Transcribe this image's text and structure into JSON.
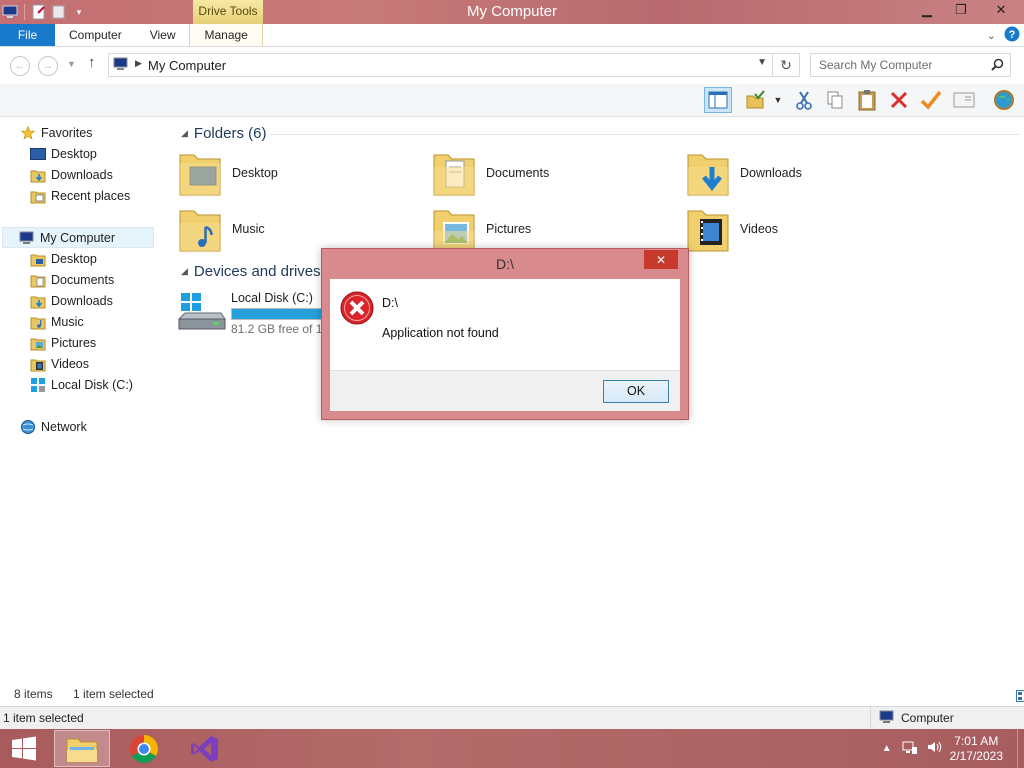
{
  "window": {
    "title": "My Computer",
    "contextual_tab": "Drive Tools"
  },
  "ribbon": {
    "tabs": [
      "File",
      "Computer",
      "View",
      "Manage"
    ]
  },
  "address": {
    "path": "My Computer",
    "search_placeholder": "Search My Computer"
  },
  "nav": {
    "favorites_label": "Favorites",
    "favorites": [
      "Desktop",
      "Downloads",
      "Recent places"
    ],
    "computer_label": "My Computer",
    "computer_items": [
      "Desktop",
      "Documents",
      "Downloads",
      "Music",
      "Pictures",
      "Videos",
      "Local Disk (C:)"
    ],
    "network_label": "Network"
  },
  "content": {
    "folders_header": "Folders (6)",
    "folders": [
      "Desktop",
      "Documents",
      "Downloads",
      "Music",
      "Pictures",
      "Videos"
    ],
    "devices_header": "Devices and drives (2",
    "drive": {
      "name": "Local Disk (C:)",
      "free_text": "81.2 GB free of 11",
      "used_fraction": 0.65
    }
  },
  "status": {
    "items": "8 items",
    "selected": "1 item selected",
    "bottom_left": "1 item selected",
    "location": "Computer"
  },
  "dialog": {
    "title": "D:\\",
    "close": "✕",
    "line1": "D:\\",
    "line2": "Application not found",
    "ok": "OK"
  },
  "taskbar": {
    "time": "7:01 AM",
    "date": "2/17/2023"
  },
  "colors": {
    "accent_title": "#c77a78",
    "file_tab": "#1979ca",
    "error_red": "#d9242a",
    "progress": "#26a0da"
  }
}
